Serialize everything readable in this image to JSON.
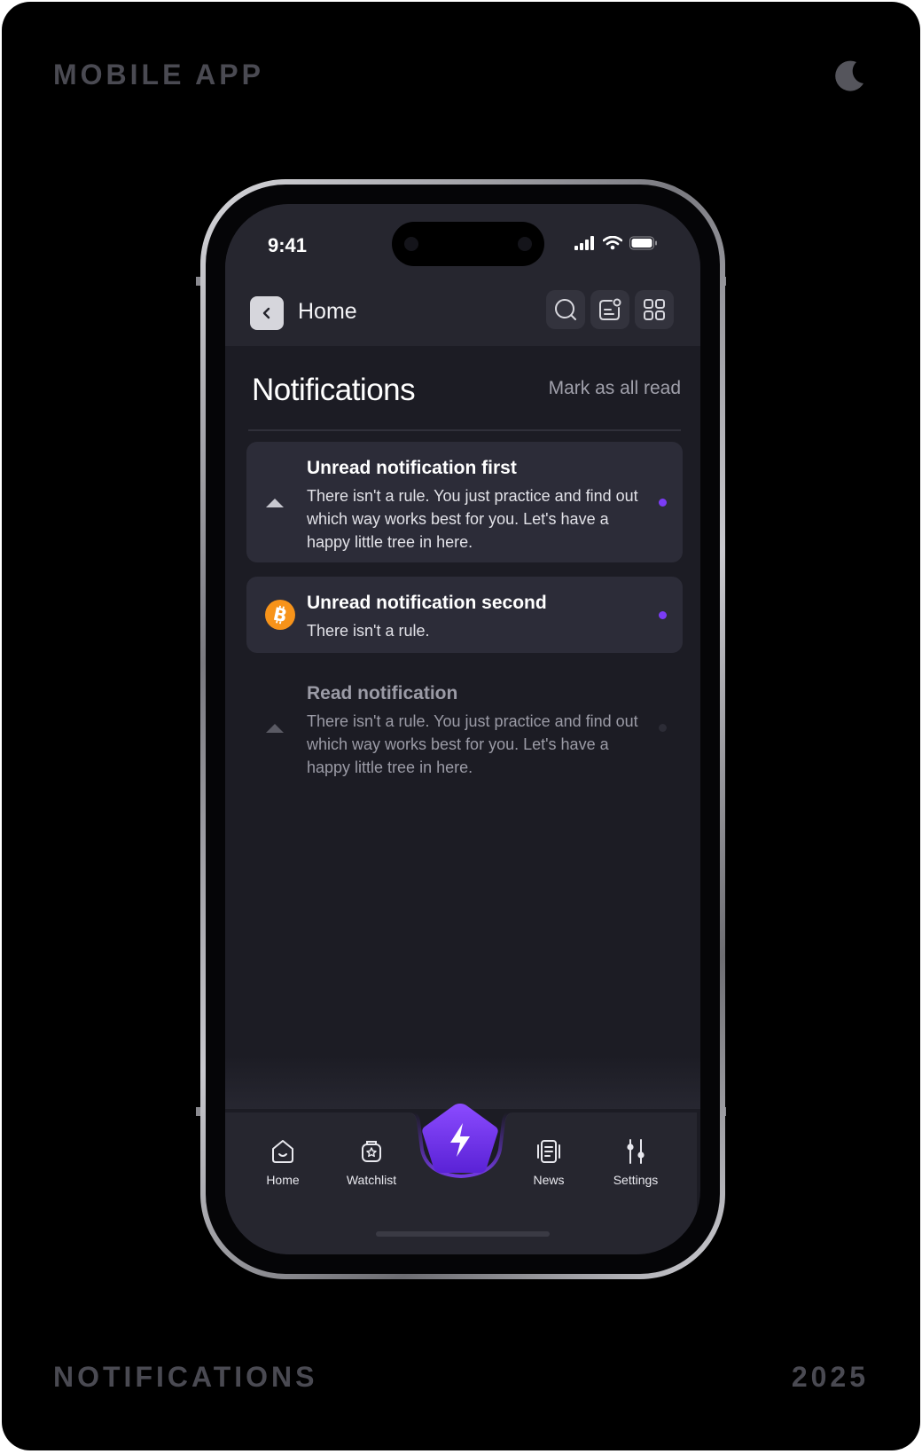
{
  "showcase": {
    "top_label": "MOBILE APP",
    "bottom_left_label": "NOTIFICATIONS",
    "bottom_right_label": "2025"
  },
  "status_bar": {
    "time": "9:41"
  },
  "header": {
    "back_label": "Home"
  },
  "page": {
    "title": "Notifications",
    "mark_all_read": "Mark as all read"
  },
  "notifications": [
    {
      "title": "Unread notification first",
      "body": "There isn't a rule. You just practice and find out which way works best for you. Let's have a happy little tree in here.",
      "icon": "triangle-up-icon",
      "state": "unread"
    },
    {
      "title": "Unread notification second",
      "body": "There isn't a rule.",
      "icon": "bitcoin-icon",
      "state": "unread"
    },
    {
      "title": "Read notification",
      "body": "There isn't a rule. You just practice and find out which way works best for you. Let's have a happy little tree in here.",
      "icon": "triangle-up-icon",
      "state": "read"
    }
  ],
  "tabbar": {
    "items": [
      {
        "label": "Home",
        "icon": "home-icon"
      },
      {
        "label": "Watchlist",
        "icon": "watchlist-icon"
      },
      {
        "label": "News",
        "icon": "news-icon"
      },
      {
        "label": "Settings",
        "icon": "settings-icon"
      }
    ],
    "center_action_icon": "lightning-icon"
  },
  "colors": {
    "accent": "#7b3cf5",
    "screen_bg": "#1c1c24",
    "card_bg": "#2c2c38",
    "bitcoin": "#f7931a"
  }
}
